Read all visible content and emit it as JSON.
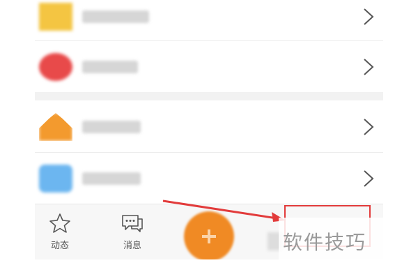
{
  "colors": {
    "accent": "#f08a24",
    "annotation": "#e23b3b",
    "tab_bar": "#f7f7f7"
  },
  "list_items": [
    {
      "icon": "yellow-folder-icon",
      "color": "#f4c542",
      "label": ""
    },
    {
      "icon": "red-record-icon",
      "color": "#e84a4a",
      "label": ""
    },
    {
      "icon": "orange-crown-icon",
      "color": "#f39a2e",
      "label": ""
    },
    {
      "icon": "blue-badge-icon",
      "color": "#6cb6f0",
      "label": ""
    }
  ],
  "tab_bar": {
    "tabs": [
      {
        "icon": "star-icon",
        "label": "动态"
      },
      {
        "icon": "message-icon",
        "label": "消息"
      },
      {
        "icon": "plus-icon",
        "label": ""
      }
    ]
  },
  "watermark": {
    "text": "软件技巧"
  }
}
